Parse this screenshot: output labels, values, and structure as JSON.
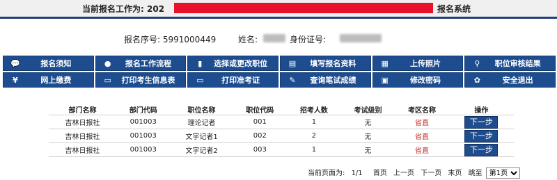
{
  "header": {
    "prefix": "当前报名工作为:",
    "visible_code": "202",
    "suffix": "报名系统"
  },
  "info": {
    "reg_no_label": "报名序号:",
    "reg_no_value": "5991000449",
    "name_label": "姓名:",
    "id_label": "身份证号:"
  },
  "menu": [
    {
      "label": "报名须知",
      "icon": "info-icon",
      "glyph": "💬"
    },
    {
      "label": "报名工作流程",
      "icon": "flow-icon",
      "glyph": "●"
    },
    {
      "label": "选择或更改职位",
      "icon": "select-icon",
      "glyph": "▮"
    },
    {
      "label": "填写报名资料",
      "icon": "form-icon",
      "glyph": "▤"
    },
    {
      "label": "上传照片",
      "icon": "upload-icon",
      "glyph": "▦"
    },
    {
      "label": "职位审核结果",
      "icon": "search-icon",
      "glyph": "⚲"
    },
    {
      "label": "网上缴费",
      "icon": "payment-icon",
      "glyph": "¥"
    },
    {
      "label": "打印考生信息表",
      "icon": "printer-icon",
      "glyph": "▭"
    },
    {
      "label": "打印准考证",
      "icon": "printer-icon",
      "glyph": "▭"
    },
    {
      "label": "查询笔试成绩",
      "icon": "query-icon",
      "glyph": "✎"
    },
    {
      "label": "修改密码",
      "icon": "password-icon",
      "glyph": "▣"
    },
    {
      "label": "安全退出",
      "icon": "logout-icon",
      "glyph": "✿"
    }
  ],
  "table": {
    "headers": [
      "部门名称",
      "部门代码",
      "职位名称",
      "职位代码",
      "招考人数",
      "考试级别",
      "考区名称",
      "操作"
    ],
    "rows": [
      [
        "吉林日报社",
        "001003",
        "理论记者",
        "001",
        "1",
        "无",
        "省直",
        "下一步"
      ],
      [
        "吉林日报社",
        "001003",
        "文字记者1",
        "002",
        "2",
        "无",
        "省直",
        "下一步"
      ],
      [
        "吉林日报社",
        "001003",
        "文字记者2",
        "003",
        "1",
        "无",
        "省直",
        "下一步"
      ]
    ]
  },
  "pager": {
    "current_label": "当前页面为:",
    "current_value": "1/1",
    "first": "首页",
    "prev": "上一页",
    "next": "下一页",
    "last": "末页",
    "jump": "跳至",
    "select_value": "第1页"
  },
  "colors": {
    "accent": "#1d4c8f",
    "redaction": "#e8102b",
    "region_text": "#c62828"
  }
}
